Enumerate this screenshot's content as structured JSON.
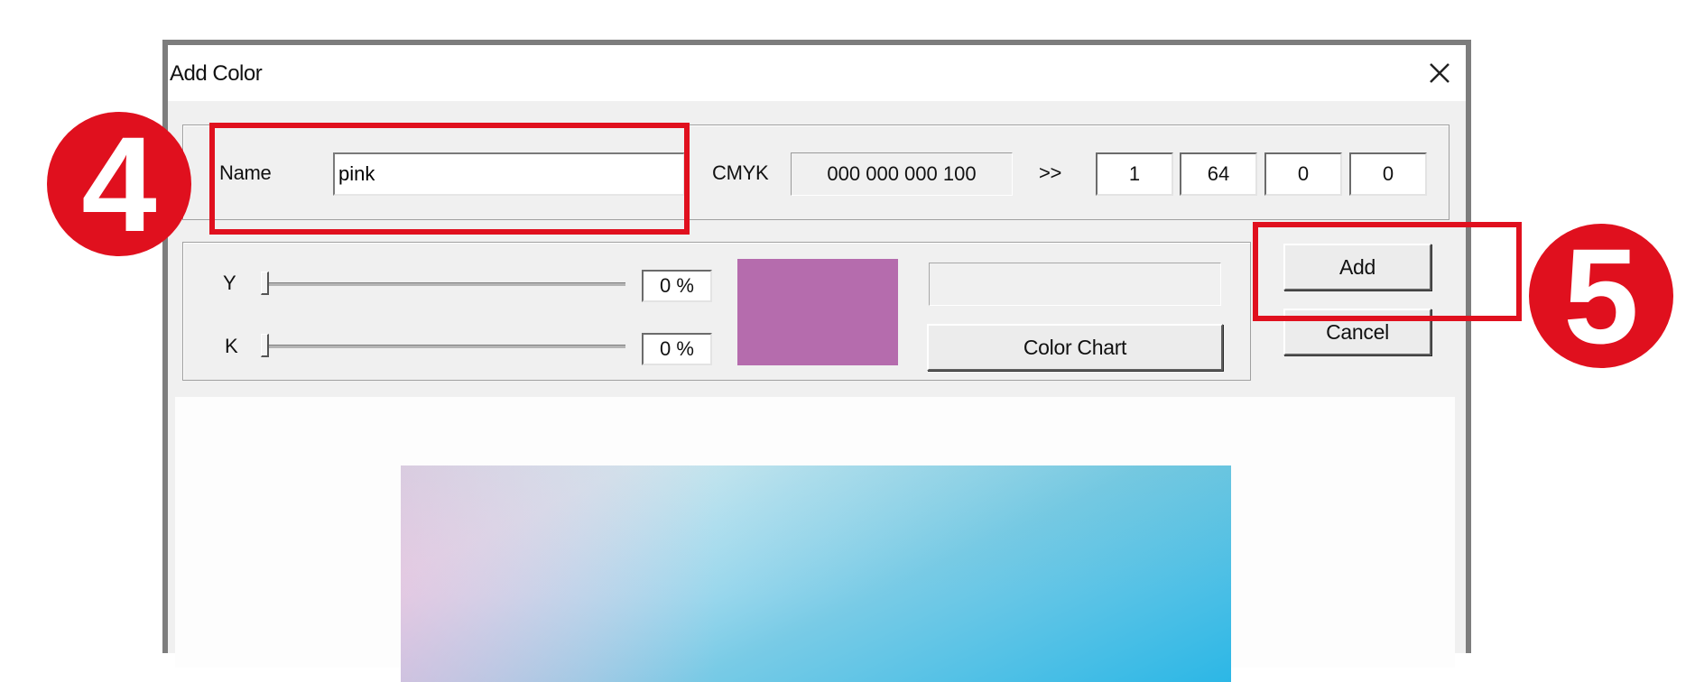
{
  "dialog": {
    "title": "Add Color"
  },
  "name_row": {
    "name_label": "Name",
    "name_value": "pink",
    "cmyk_label": "CMYK",
    "cmyk_readout": "000 000 000 100",
    "arrow_label": ">>",
    "cmyk_inputs": [
      "1",
      "64",
      "0",
      "0"
    ]
  },
  "sliders": [
    {
      "label": "Y",
      "value_text": "0 %",
      "level": 0
    },
    {
      "label": "K",
      "value_text": "0 %",
      "level": 0
    }
  ],
  "preview": {
    "swatch_color": "#b56cad",
    "color_chart_button": "Color Chart"
  },
  "buttons": {
    "add": "Add",
    "cancel": "Cancel"
  },
  "annotations": {
    "step_4": "4",
    "step_5": "5",
    "highlight_color": "#e0101e"
  }
}
